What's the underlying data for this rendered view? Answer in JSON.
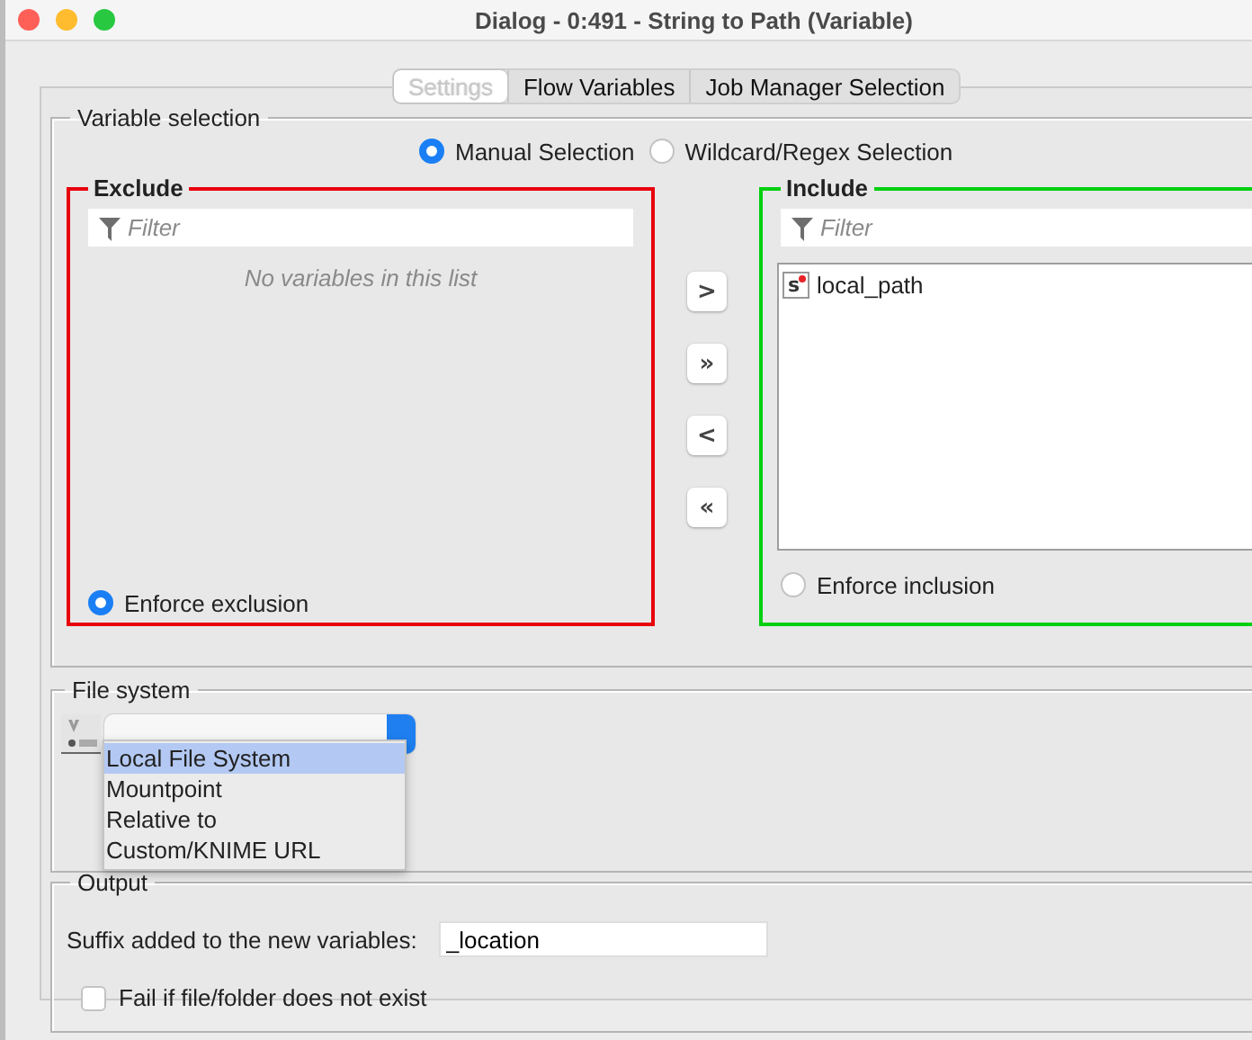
{
  "window": {
    "title": "Dialog - 0:491 - String to Path (Variable)"
  },
  "tabs": [
    {
      "label": "Settings",
      "selected": true
    },
    {
      "label": "Flow Variables",
      "selected": false
    },
    {
      "label": "Job Manager Selection",
      "selected": false
    }
  ],
  "variable_selection": {
    "title": "Variable selection",
    "modes": [
      {
        "label": "Manual Selection",
        "selected": true
      },
      {
        "label": "Wildcard/Regex Selection",
        "selected": false
      }
    ],
    "exclude": {
      "title": "Exclude",
      "color": "#e8000b",
      "filter_placeholder": "Filter",
      "empty_message": "No variables in this list",
      "enforce": {
        "label": "Enforce exclusion",
        "selected": true
      }
    },
    "move_buttons": [
      ">",
      "»",
      "<",
      "«"
    ],
    "include": {
      "title": "Include",
      "color": "#00d00f",
      "filter_placeholder": "Filter",
      "items": [
        {
          "type_badge": "s",
          "label": "local_path"
        }
      ],
      "enforce": {
        "label": "Enforce inclusion",
        "selected": false
      }
    }
  },
  "file_system": {
    "title": "File system",
    "expanded": true,
    "options": [
      {
        "label": "Local File System",
        "selected": true
      },
      {
        "label": "Mountpoint",
        "selected": false
      },
      {
        "label": "Relative to",
        "selected": false
      },
      {
        "label": "Custom/KNIME URL",
        "selected": false
      }
    ]
  },
  "output": {
    "title": "Output",
    "suffix_label": "Suffix added to the new variables:",
    "suffix_value": "_location",
    "fail_check": {
      "label": "Fail if file/folder does not exist",
      "checked": false
    }
  }
}
